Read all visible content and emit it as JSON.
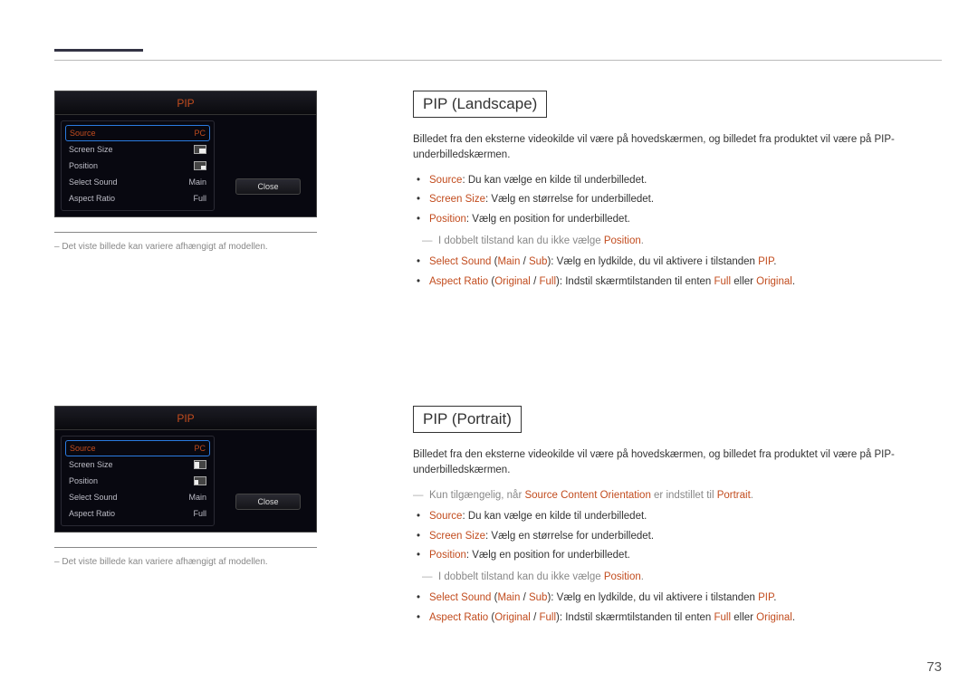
{
  "page_number": "73",
  "osd_landscape": {
    "title": "PIP",
    "rows": [
      {
        "label": "Source",
        "value": "PC",
        "selected": true
      },
      {
        "label": "Screen Size",
        "icon": "size-landscape"
      },
      {
        "label": "Position",
        "icon": "pos-landscape"
      },
      {
        "label": "Select Sound",
        "value": "Main"
      },
      {
        "label": "Aspect Ratio",
        "value": "Full"
      }
    ],
    "close": "Close",
    "footnote": "Det viste billede kan variere afhængigt af modellen."
  },
  "osd_portrait": {
    "title": "PIP",
    "rows": [
      {
        "label": "Source",
        "value": "PC",
        "selected": true
      },
      {
        "label": "Screen Size",
        "icon": "size-portrait"
      },
      {
        "label": "Position",
        "icon": "pos-portrait"
      },
      {
        "label": "Select Sound",
        "value": "Main"
      },
      {
        "label": "Aspect Ratio",
        "value": "Full"
      }
    ],
    "close": "Close",
    "footnote": "Det viste billede kan variere afhængigt af modellen."
  },
  "section_landscape": {
    "heading": "PIP (Landscape)",
    "intro": "Billedet fra den eksterne videokilde vil være på hovedskærmen, og billedet fra produktet vil være på PIP-underbilledskærmen.",
    "items": {
      "source_kw": "Source",
      "source_txt": ": Du kan vælge en kilde til underbilledet.",
      "screen_kw": "Screen Size",
      "screen_txt": ": Vælg en størrelse for underbilledet.",
      "position_kw": "Position",
      "position_txt": ": Vælg en position for underbilledet.",
      "note1_pre": "I dobbelt tilstand kan du ikke vælge ",
      "note1_kw": "Position",
      "note1_post": ".",
      "selsound_kw": "Select Sound",
      "selsound_paren_pre": " (",
      "selsound_main": "Main",
      "selsound_sep": " / ",
      "selsound_sub": "Sub",
      "selsound_paren_post": ")",
      "selsound_txt": ": Vælg en lydkilde, du vil aktivere i tilstanden ",
      "selsound_pip": "PIP",
      "selsound_end": ".",
      "aspect_kw": "Aspect Ratio",
      "aspect_paren_pre": " (",
      "aspect_orig": "Original",
      "aspect_sep": " / ",
      "aspect_full": "Full",
      "aspect_paren_post": ")",
      "aspect_txt": ": Indstil skærmtilstanden til enten ",
      "aspect_full2": "Full",
      "aspect_or": " eller ",
      "aspect_orig2": "Original",
      "aspect_end": "."
    }
  },
  "section_portrait": {
    "heading": "PIP (Portrait)",
    "intro": "Billedet fra den eksterne videokilde vil være på hovedskærmen, og billedet fra produktet vil være på PIP-underbilledskærmen.",
    "avail_pre": "Kun tilgængelig, når ",
    "avail_kw": "Source Content Orientation",
    "avail_mid": " er indstillet til ",
    "avail_kw2": "Portrait",
    "avail_post": ".",
    "items": {
      "source_kw": "Source",
      "source_txt": ": Du kan vælge en kilde til underbilledet.",
      "screen_kw": "Screen Size",
      "screen_txt": ": Vælg en størrelse for underbilledet.",
      "position_kw": "Position",
      "position_txt": ": Vælg en position for underbilledet.",
      "note1_pre": "I dobbelt tilstand kan du ikke vælge ",
      "note1_kw": "Position",
      "note1_post": ".",
      "selsound_kw": "Select Sound",
      "selsound_paren_pre": " (",
      "selsound_main": "Main",
      "selsound_sep": " / ",
      "selsound_sub": "Sub",
      "selsound_paren_post": ")",
      "selsound_txt": ": Vælg en lydkilde, du vil aktivere i tilstanden ",
      "selsound_pip": "PIP",
      "selsound_end": ".",
      "aspect_kw": "Aspect Ratio",
      "aspect_paren_pre": " (",
      "aspect_orig": "Original",
      "aspect_sep": " / ",
      "aspect_full": "Full",
      "aspect_paren_post": ")",
      "aspect_txt": ": Indstil skærmtilstanden til enten ",
      "aspect_full2": "Full",
      "aspect_or": " eller ",
      "aspect_orig2": "Original",
      "aspect_end": "."
    }
  }
}
